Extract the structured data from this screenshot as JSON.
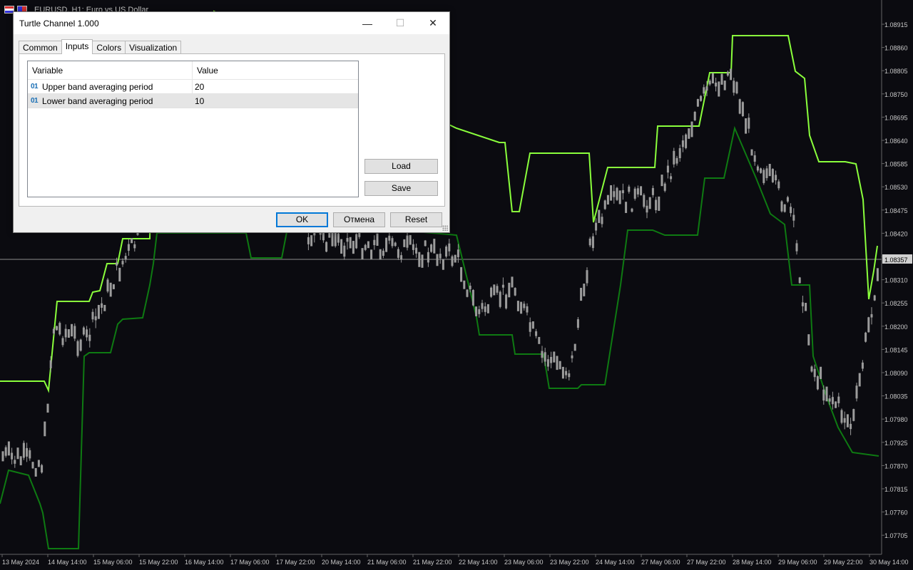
{
  "chart": {
    "window_title": "EURUSD, H1:  Euro vs US Dollar",
    "price_levels": [
      "1.08915",
      "1.08860",
      "1.08805",
      "1.08750",
      "1.08695",
      "1.08640",
      "1.08585",
      "1.08530",
      "1.08475",
      "1.08420",
      "1.08365",
      "1.08310",
      "1.08255",
      "1.08200",
      "1.08145",
      "1.08090",
      "1.08035",
      "1.07980",
      "1.07925",
      "1.07870",
      "1.07815",
      "1.07760",
      "1.07705"
    ],
    "current_price": "1.08357",
    "time_labels": [
      "13 May 2024",
      "14 May 14:00",
      "15 May 06:00",
      "15 May 22:00",
      "16 May 14:00",
      "17 May 06:00",
      "17 May 22:00",
      "20 May 14:00",
      "21 May 06:00",
      "21 May 22:00",
      "22 May 14:00",
      "23 May 06:00",
      "23 May 22:00",
      "24 May 14:00",
      "27 May 06:00",
      "27 May 22:00",
      "28 May 14:00",
      "29 May 06:00",
      "29 May 22:00",
      "30 May 14:00"
    ],
    "colors": {
      "background": "#0b0b10",
      "upper_band": "#8aff3c",
      "lower_band": "#0e7a12",
      "candles": "#9c9c9c",
      "axis_text": "#c8c8c8",
      "price_line": "#8c8c8c"
    }
  },
  "dialog": {
    "title": "Turtle Channel 1.000",
    "tabs": [
      {
        "label": "Common"
      },
      {
        "label": "Inputs"
      },
      {
        "label": "Colors"
      },
      {
        "label": "Visualization"
      }
    ],
    "grid": {
      "header_variable": "Variable",
      "header_value": "Value",
      "rows": [
        {
          "type": "01",
          "variable": "Upper band averaging period",
          "value": "20"
        },
        {
          "type": "01",
          "variable": "Lower band averaging period",
          "value": "10"
        }
      ]
    },
    "load_label": "Load",
    "save_label": "Save",
    "ok_label": "OK",
    "cancel_label": "Отмена",
    "reset_label": "Reset"
  }
}
